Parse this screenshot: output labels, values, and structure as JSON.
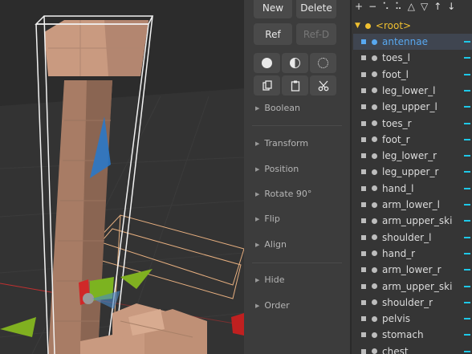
{
  "tools": {
    "new_label": "New",
    "delete_label": "Delete",
    "ref_label": "Ref",
    "refd_label": "Ref-D",
    "icons": [
      "solid-sphere-icon",
      "half-sphere-icon",
      "dotted-circle-icon",
      "copy-icon",
      "paste-icon",
      "scissors-icon"
    ],
    "sections": {
      "boolean": "Boolean",
      "transform": "Transform",
      "position": "Position",
      "rotate": "Rotate 90°",
      "flip": "Flip",
      "align": "Align",
      "hide": "Hide",
      "order": "Order"
    }
  },
  "outliner": {
    "toolbar_icons": [
      "plus-icon",
      "minus-icon",
      "connect-icon",
      "link-icon",
      "triangle-up-icon",
      "triangle-down-icon",
      "arrow-up-icon",
      "arrow-down-icon"
    ],
    "toolbar_glyphs": [
      "+",
      "−",
      "⠡",
      "⠥",
      "△",
      "▽",
      "↑",
      "↓"
    ],
    "root_label": "<root>",
    "items": [
      {
        "label": "antennae",
        "selected": true
      },
      {
        "label": "toes_l"
      },
      {
        "label": "foot_l"
      },
      {
        "label": "leg_lower_l"
      },
      {
        "label": "leg_upper_l"
      },
      {
        "label": "toes_r"
      },
      {
        "label": "foot_r"
      },
      {
        "label": "leg_lower_r"
      },
      {
        "label": "leg_upper_r"
      },
      {
        "label": "hand_l"
      },
      {
        "label": "arm_lower_l"
      },
      {
        "label": "arm_upper_ski"
      },
      {
        "label": "shoulder_l"
      },
      {
        "label": "hand_r"
      },
      {
        "label": "arm_lower_r"
      },
      {
        "label": "arm_upper_ski"
      },
      {
        "label": "shoulder_r"
      },
      {
        "label": "pelvis"
      },
      {
        "label": "stomach"
      },
      {
        "label": "chest"
      }
    ]
  },
  "colors": {
    "selection": "#58a8f0",
    "root": "#f0c030",
    "visibility_marker": "#1ec8e8",
    "model_skin": "#c99a80"
  }
}
